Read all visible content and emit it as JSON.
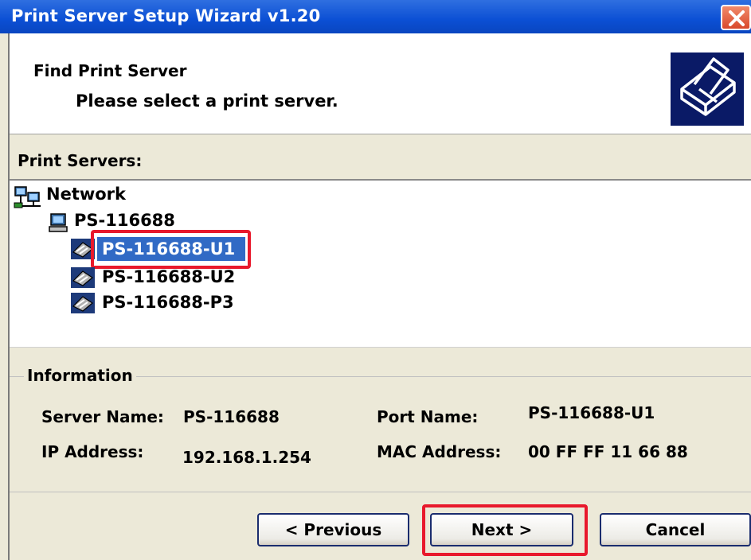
{
  "window": {
    "title": "Print Server Setup Wizard v1.20",
    "close_label": "Close"
  },
  "header": {
    "title": "Find Print Server",
    "subtitle": "Please select a print server."
  },
  "servers": {
    "label": "Print Servers:",
    "tree": {
      "root": "Network",
      "host": "PS-116688",
      "ports": [
        "PS-116688-U1",
        "PS-116688-U2",
        "PS-116688-P3"
      ],
      "selected": "PS-116688-U1"
    }
  },
  "info": {
    "legend": "Information",
    "server_name_label": "Server Name:",
    "server_name_value": "PS-116688",
    "port_name_label": "Port Name:",
    "port_name_value": "PS-116688-U1",
    "ip_label": "IP Address:",
    "ip_value": "192.168.1.254",
    "mac_label": "MAC Address:",
    "mac_value": "00 FF FF 11 66 88"
  },
  "buttons": {
    "previous": "< Previous",
    "next": "Next >",
    "cancel": "Cancel"
  },
  "colors": {
    "titlebar": "#0b4fd4",
    "selection": "#316ac5",
    "highlight_box": "#e8192c",
    "dialog_bg": "#ece9d8"
  }
}
